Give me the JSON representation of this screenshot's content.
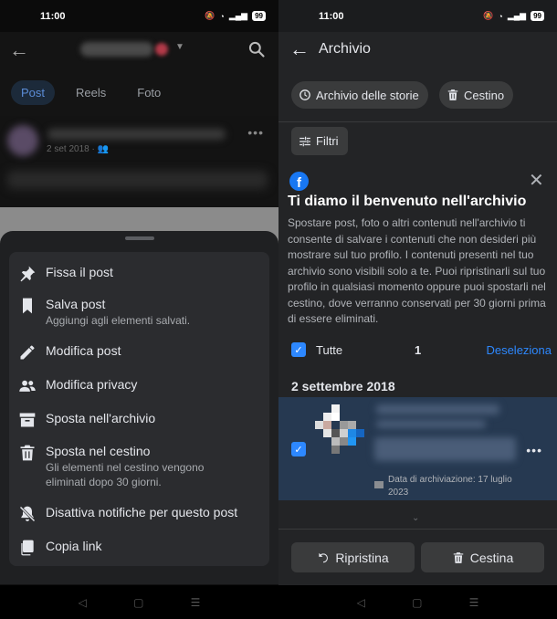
{
  "left": {
    "status": {
      "time": "11:00",
      "battery": "99"
    },
    "tabs": [
      {
        "label": "Post",
        "active": true
      },
      {
        "label": "Reels",
        "active": false
      },
      {
        "label": "Foto",
        "active": false
      }
    ],
    "feed_date": "2 set 2018",
    "menu": {
      "pin": {
        "title": "Fissa il post"
      },
      "save": {
        "title": "Salva post",
        "subtitle": "Aggiungi agli elementi salvati."
      },
      "edit": {
        "title": "Modifica post"
      },
      "privacy": {
        "title": "Modifica privacy"
      },
      "archive": {
        "title": "Sposta nell'archivio"
      },
      "trash": {
        "title": "Sposta nel cestino",
        "subtitle": "Gli elementi nel cestino vengono eliminati dopo 30 giorni."
      },
      "notif": {
        "title": "Disattiva notifiche per questo post"
      },
      "link": {
        "title": "Copia link"
      }
    }
  },
  "right": {
    "status": {
      "time": "11:00",
      "battery": "99"
    },
    "header_title": "Archivio",
    "chips": {
      "stories": "Archivio delle storie",
      "trash": "Cestino"
    },
    "filter_label": "Filtri",
    "welcome": {
      "title": "Ti diamo il benvenuto nell'archivio",
      "body": "Spostare post, foto o altri contenuti nell'archivio ti consente di salvare i contenuti che non desideri più mostrare sul tuo profilo. I contenuti presenti nel tuo archivio sono visibili solo a te. Puoi ripristinarli sul tuo profilo in qualsiasi momento oppure puoi spostarli nel cestino, dove verranno conservati per 30 giorni prima di essere eliminati."
    },
    "select_all": {
      "label": "Tutte",
      "count": "1",
      "deselect": "Deseleziona"
    },
    "date_heading": "2 settembre 2018",
    "archived_item": {
      "archive_date": "Data di archiviazione: 17 luglio 2023"
    },
    "actions": {
      "restore": "Ripristina",
      "trash": "Cestina"
    }
  },
  "colors": {
    "accent": "#2d88ff",
    "selected_row": "#263951",
    "sheet": "#2b2c2f"
  }
}
